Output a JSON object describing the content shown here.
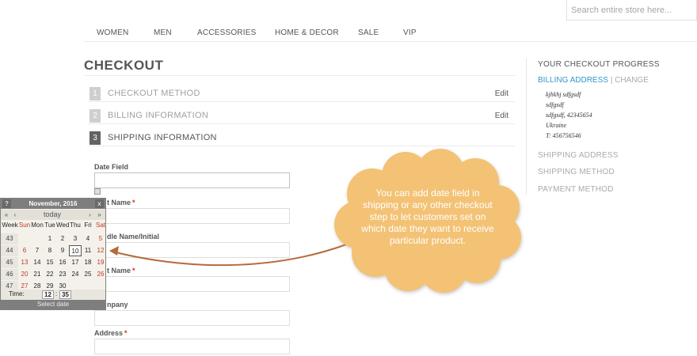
{
  "search": {
    "placeholder": "Search entire store here..."
  },
  "nav": [
    "WOMEN",
    "MEN",
    "ACCESSORIES",
    "HOME & DECOR",
    "SALE",
    "VIP"
  ],
  "page_title": "CHECKOUT",
  "steps": [
    {
      "num": "1",
      "label": "CHECKOUT METHOD",
      "edit": "Edit"
    },
    {
      "num": "2",
      "label": "BILLING INFORMATION",
      "edit": "Edit"
    },
    {
      "num": "3",
      "label": "SHIPPING INFORMATION"
    }
  ],
  "fields": {
    "date": "Date Field",
    "first_name": "t Name",
    "middle_name": "dle Name/Initial",
    "last_name": "t Name",
    "company": "npany",
    "address": "Address",
    "required_mark": "*"
  },
  "calendar": {
    "help": "?",
    "month": "November, 2016",
    "close": "x",
    "prev_year": "«",
    "prev_month": "‹",
    "today": "today",
    "next_month": "›",
    "next_year": "»",
    "dow": [
      "Week",
      "Sun",
      "Mon",
      "Tue",
      "Wed",
      "Thu",
      "Fri",
      "Sat"
    ],
    "weeks": [
      {
        "wk": "43",
        "days": [
          "",
          "",
          "1",
          "2",
          "3",
          "4",
          "5"
        ]
      },
      {
        "wk": "44",
        "days": [
          "6",
          "7",
          "8",
          "9",
          "10",
          "11",
          "12"
        ]
      },
      {
        "wk": "45",
        "days": [
          "13",
          "14",
          "15",
          "16",
          "17",
          "18",
          "19"
        ]
      },
      {
        "wk": "46",
        "days": [
          "20",
          "21",
          "22",
          "23",
          "24",
          "25",
          "26"
        ]
      },
      {
        "wk": "47",
        "days": [
          "27",
          "28",
          "29",
          "30",
          "",
          "",
          ""
        ]
      }
    ],
    "time_label": "Time:",
    "hour": "12",
    "colon": ":",
    "minute": "35",
    "footer": "Select date"
  },
  "callout": {
    "text": "You can add date field in shipping or any other checkout step to let customers set on which date they want to receive particular product.",
    "color": "#f3c275",
    "arrow_color": "#b86a3a"
  },
  "sidebar": {
    "title": "YOUR CHECKOUT PROGRESS",
    "billing": "BILLING ADDRESS",
    "divider": "|",
    "change": "CHANGE",
    "address": [
      "kjhkhj sdfgsdf",
      "sdfgsdf",
      "sdfgsdf, 42345654",
      "Ukraine",
      "T: 456756546"
    ],
    "shipping_address": "SHIPPING ADDRESS",
    "shipping_method": "SHIPPING METHOD",
    "payment_method": "PAYMENT METHOD"
  }
}
